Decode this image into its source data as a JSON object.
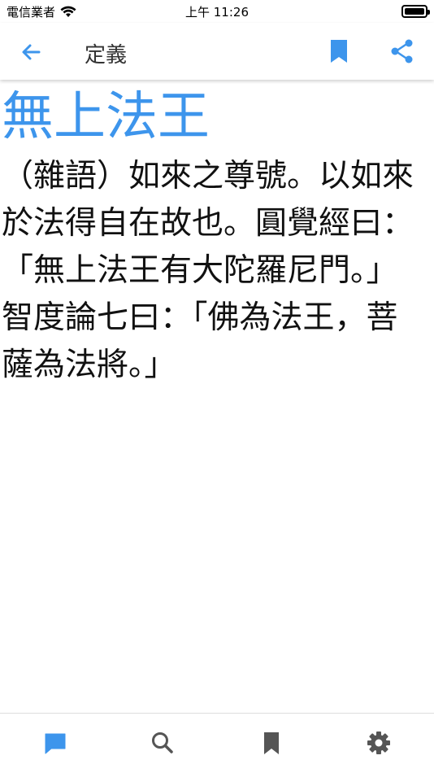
{
  "status_bar": {
    "carrier": "電信業者",
    "time": "上午 11:26",
    "battery_level": 1.0
  },
  "nav": {
    "title": "定義",
    "back_icon": "arrow-left-icon",
    "bookmark_icon": "bookmark-icon",
    "share_icon": "share-icon"
  },
  "entry": {
    "term": "無上法王",
    "definition": "（雜語）如來之尊號。以如來於法得自在故也。圓覺經曰：「無上法王有大陀羅尼門。」智度論七曰：「佛為法王，菩薩為法將。」"
  },
  "tabs": [
    {
      "name": "definition",
      "icon": "chat-bubble-icon",
      "active": true
    },
    {
      "name": "search",
      "icon": "search-icon",
      "active": false
    },
    {
      "name": "bookmarks",
      "icon": "bookmark-icon",
      "active": false
    },
    {
      "name": "settings",
      "icon": "gear-icon",
      "active": false
    }
  ],
  "colors": {
    "accent": "#3d95ec",
    "inactive_icon": "#555555",
    "text": "#111111"
  }
}
